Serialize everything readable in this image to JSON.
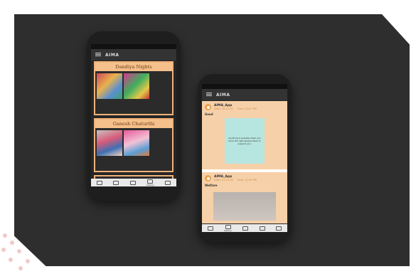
{
  "app": {
    "title": "AIMA"
  },
  "bottom_nav": {
    "left_phone": [
      "",
      "",
      "",
      "Gallery",
      ""
    ],
    "right_phone": [
      "",
      "Gallery",
      "",
      "",
      ""
    ]
  },
  "gallery": {
    "albums": [
      {
        "title": "Dandiya Nights"
      },
      {
        "title": "Ganesh Chaturthi"
      }
    ]
  },
  "feed": {
    "posts": [
      {
        "author": "AIMA_App",
        "date": "Date: 18-10-18",
        "time": "Time: 03:07 PM",
        "caption": "Good",
        "quote": "Anything is possible when you have the right people there to support you."
      },
      {
        "author": "AIMA_App",
        "date": "Date: 13-10-18",
        "time": "Time: 12:34 PM",
        "caption": "Welfare"
      }
    ]
  },
  "icons": [
    "menu-icon",
    "home-icon",
    "chat-icon",
    "events-icon",
    "gallery-icon",
    "profile-icon",
    "avatar-icon"
  ]
}
